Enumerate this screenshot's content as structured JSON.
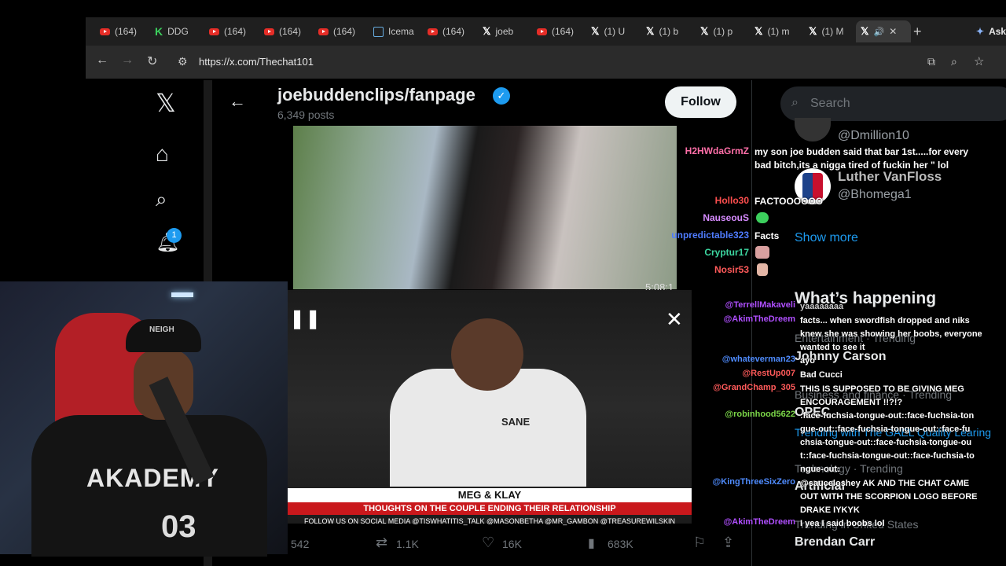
{
  "browser": {
    "tabs": [
      {
        "icon": "youtube-icon",
        "label": "(164)"
      },
      {
        "icon": "ddg-icon",
        "label": "DDG"
      },
      {
        "icon": "youtube-icon",
        "label": "(164)"
      },
      {
        "icon": "youtube-icon",
        "label": "(164)"
      },
      {
        "icon": "youtube-icon",
        "label": "(164)"
      },
      {
        "icon": "iceman-icon",
        "label": "Icema"
      },
      {
        "icon": "youtube-icon",
        "label": "(164)"
      },
      {
        "icon": "x-icon",
        "label": "joeb"
      },
      {
        "icon": "youtube-icon",
        "label": "(164)"
      },
      {
        "icon": "x-icon",
        "label": "(1) U"
      },
      {
        "icon": "x-icon",
        "label": "(1) b"
      },
      {
        "icon": "x-icon",
        "label": "(1) p"
      },
      {
        "icon": "x-icon",
        "label": "(1) m"
      },
      {
        "icon": "x-icon",
        "label": "(1) M"
      }
    ],
    "active_tab_close": "✕",
    "new_tab": "+",
    "ask_label": "Ask",
    "url": "https://x.com/Thechat101"
  },
  "sidebar": {
    "logo": "𝕏",
    "notification_count": "1"
  },
  "profile": {
    "name": "joebuddenclips/fanpage",
    "posts": "6,349 posts",
    "follow_label": "Follow"
  },
  "post": {
    "video_time": "5:08:1",
    "replies": "542",
    "reposts": "1.1K",
    "likes": "16K",
    "views": "683K"
  },
  "overlay_video": {
    "banner_title": "MEG & KLAY",
    "banner_sub": "THOUGHTS ON THE COUPLE ENDING THEIR RELATIONSHIP",
    "banner_follow": "FOLLOW US ON SOCIAL MEDIA @TISWHATITIS_TALK @MASONBETHA @MR_GAMBON @TREASUREWILSKIN",
    "shirt_text": "SANE"
  },
  "right": {
    "search_placeholder": "Search",
    "sug1_handle": "@Dmillion10",
    "sug2_name": "Luther VanFloss",
    "sug2_handle": "@Bhomega1",
    "show_more": "Show more",
    "whats_happening": "What’s happening",
    "trend1_cat": "Entertainment · Trending",
    "trend1_name": "Johnny Carson",
    "trend2_cat": "Business and finance · Trending",
    "trend2_name": "OPEC",
    "trend3_cat": "Trending with The GAEL Quality Learing",
    "trend4_cat": "Technology · Trending",
    "trend4_name": "Artificial",
    "trend5_cat": "Trending in United States",
    "trend5_name": "Brendan Carr"
  },
  "chat_top": [
    {
      "user": "H2HWdaGrmZ",
      "color": "#ff6fa8",
      "msg": "my son joe budden said that bar 1st.....for every bad bitch,its a nigga tired of fuckin her \" lol"
    },
    {
      "user": "Hollo30",
      "color": "#ff4f4f",
      "msg": "FACTOOOOOO"
    },
    {
      "user": "NauseouS",
      "color": "#d78cff",
      "msg": ""
    },
    {
      "user": "unpredictable323",
      "color": "#4f7cff",
      "msg": "Facts"
    },
    {
      "user": "Cryptur17",
      "color": "#3cd6a0",
      "msg": ""
    },
    {
      "user": "Nosir53",
      "color": "#ff5a5a",
      "msg": ""
    }
  ],
  "chat_bottom": [
    {
      "user": "@TerrellMakaveli",
      "color": "#b04fff",
      "msg": "yaaaaaaaa"
    },
    {
      "user": "@AkimTheDreem",
      "color": "#b04fff",
      "msg": "facts... when swordfish dropped and niks knew she was showing her boobs, everyone wanted to see it"
    },
    {
      "user": "@whateverman23",
      "color": "#4f8cff",
      "msg": "ayo"
    },
    {
      "user": "@RestUp007",
      "color": "#ff5a5a",
      "msg": "Bad Cucci"
    },
    {
      "user": "@GrandChamp_305",
      "color": "#ff5a5a",
      "msg": "THIS IS SUPPOSED TO BE GIVING MEG ENCOURAGEMENT !!?!?"
    },
    {
      "user": "@robinhood5622",
      "color": "#7bd648",
      "msg": ":face-fuchsia-tongue-out::face-fuchsia-tongue-out::face-fuchsia-tongue-out::face-fuchsia-tongue-out::face-fuchsia-tongue-out::face-fuchsia-tongue-out::face-fuchsia-tongue-out:"
    },
    {
      "user": "@KingThreeSixZero",
      "color": "#4f8cff",
      "msg": "@sauceloshey AK AND THE CHAT CAME OUT WITH THE SCORPION LOGO BEFORE DRAKE IYKYK"
    },
    {
      "user": "@AkimTheDreem",
      "color": "#b04fff",
      "msg": "I yea I said boobs lol"
    }
  ],
  "webcam": {
    "jersey_text": "AKADEMY",
    "jersey_number": "03",
    "cap_text": "NEIGH"
  }
}
